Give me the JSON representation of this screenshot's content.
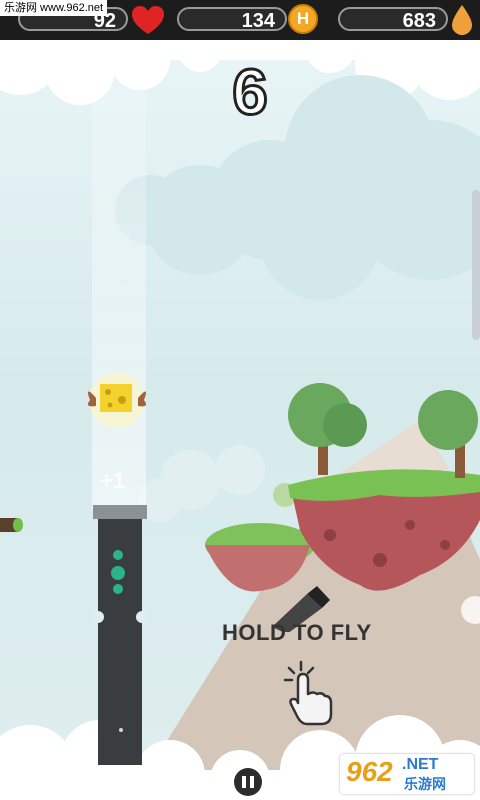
{
  "hud": {
    "lives": "92",
    "coins": "134",
    "drops": "683",
    "coin_badge_letter": "H"
  },
  "game": {
    "score": "6",
    "bonus_popup": "+1",
    "instruction": "HOLD TO FLY"
  },
  "watermark": {
    "top_left": "乐游网 www.962.net",
    "bottom_right_brand": "962",
    "bottom_right_suffix": ".NET",
    "bottom_right_cn": "乐游网"
  },
  "icons": {
    "lives": "heart-icon",
    "coins": "coin-icon",
    "drops": "drop-icon",
    "pause": "pause-icon",
    "tap": "tap-hand-icon",
    "player": "winged-cheese-icon"
  },
  "colors": {
    "heart": "#e02424",
    "coin": "#f5a623",
    "drop": "#f0a03a",
    "pillar": "#3a3d3f",
    "pillar_lights": "#2bb38a",
    "cheese": "#f3d22b",
    "grass": "#79c152",
    "soil": "#b5565a"
  }
}
